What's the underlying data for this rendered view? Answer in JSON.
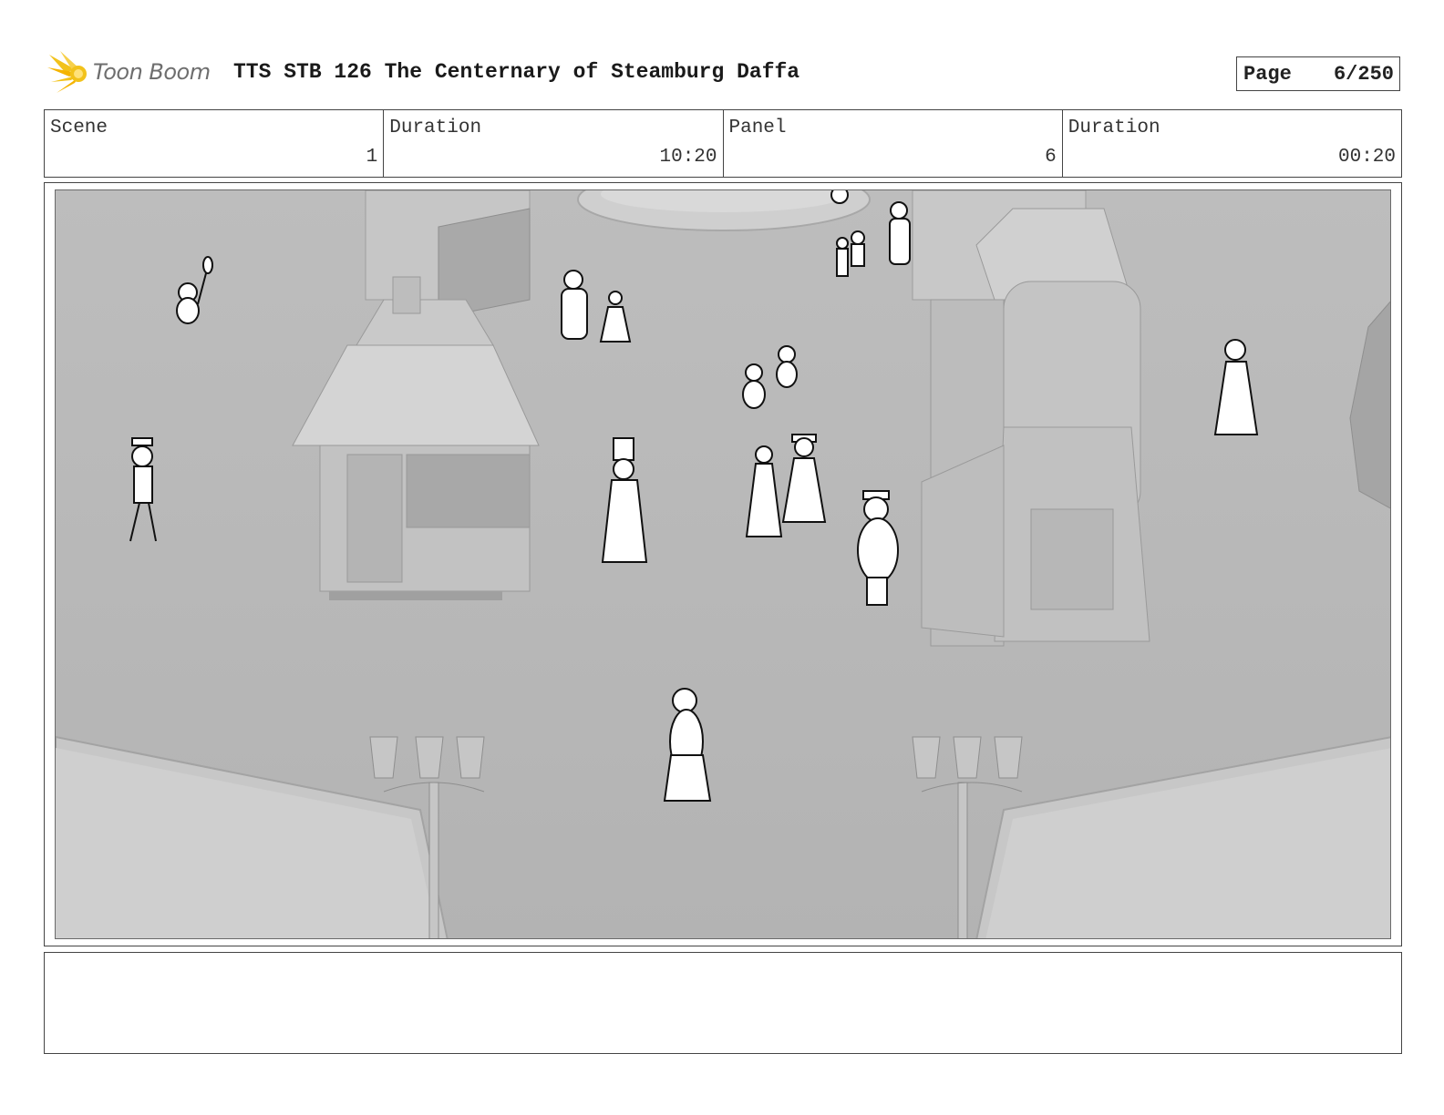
{
  "header": {
    "logo_text": "Toon Boom",
    "title": "TTS STB 126 The Centernary of Steamburg Daffa",
    "page_label": "Page",
    "page_value": "6/250"
  },
  "info": {
    "scene_label": "Scene",
    "scene_value": "1",
    "scene_duration_label": "Duration",
    "scene_duration_value": "10:20",
    "panel_label": "Panel",
    "panel_value": "6",
    "panel_duration_label": "Duration",
    "panel_duration_value": "00:20"
  },
  "colors": {
    "logo_accent": "#f2c21b",
    "frame_border": "#444444",
    "scene_background": "#b9b9b9"
  }
}
